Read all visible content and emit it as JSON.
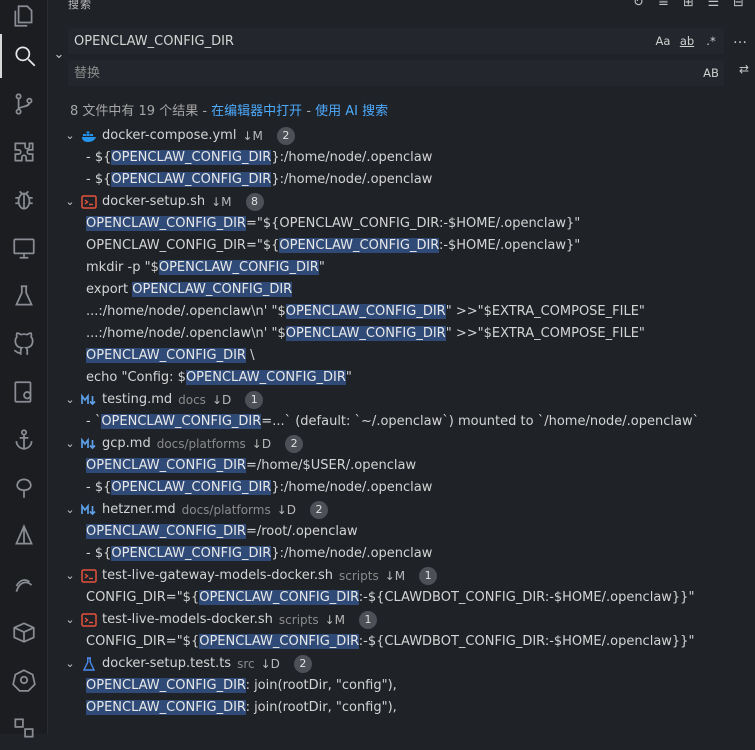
{
  "panel": {
    "title": "搜索"
  },
  "search": {
    "value": "OPENCLAW_CONFIG_DIR",
    "opt_case": "Aa",
    "opt_word": "ab",
    "opt_regex": ".*"
  },
  "replace": {
    "placeholder": "替换",
    "opt_preserve": "AB"
  },
  "summary": {
    "text": "8 文件中有 19 个结果 - ",
    "open_editor": "在编辑器中打开",
    "sep": " - ",
    "ai": "使用 AI 搜索"
  },
  "files": [
    {
      "name": "docker-compose.yml",
      "dir": "",
      "status": "↓M",
      "count": "2",
      "icon": "docker-icon",
      "matches": [
        {
          "pre": "- ${",
          "hl": "OPENCLAW_CONFIG_DIR",
          "post": "}:/home/node/.openclaw"
        },
        {
          "pre": "- ${",
          "hl": "OPENCLAW_CONFIG_DIR",
          "post": "}:/home/node/.openclaw"
        }
      ]
    },
    {
      "name": "docker-setup.sh",
      "dir": "",
      "status": "↓M",
      "count": "8",
      "icon": "shell-icon",
      "matches": [
        {
          "pre": "",
          "hl": "OPENCLAW_CONFIG_DIR",
          "post": "=\"${OPENCLAW_CONFIG_DIR:-$HOME/.openclaw}\""
        },
        {
          "pre": "OPENCLAW_CONFIG_DIR=\"${",
          "hl": "OPENCLAW_CONFIG_DIR",
          "post": ":-$HOME/.openclaw}\""
        },
        {
          "pre": "mkdir -p \"$",
          "hl": "OPENCLAW_CONFIG_DIR",
          "post": "\""
        },
        {
          "pre": "export ",
          "hl": "OPENCLAW_CONFIG_DIR",
          "post": ""
        },
        {
          "pre": "...:/home/node/.openclaw\\n' \"$",
          "hl": "OPENCLAW_CONFIG_DIR",
          "post": "\" >>\"$EXTRA_COMPOSE_FILE\""
        },
        {
          "pre": "...:/home/node/.openclaw\\n' \"$",
          "hl": "OPENCLAW_CONFIG_DIR",
          "post": "\" >>\"$EXTRA_COMPOSE_FILE\""
        },
        {
          "pre": "",
          "hl": "OPENCLAW_CONFIG_DIR",
          "post": " \\"
        },
        {
          "pre": "echo \"Config: $",
          "hl": "OPENCLAW_CONFIG_DIR",
          "post": "\""
        }
      ]
    },
    {
      "name": "testing.md",
      "dir": "docs",
      "status": "↓D",
      "count": "1",
      "icon": "markdown-icon",
      "matches": [
        {
          "pre": "- `",
          "hl": "OPENCLAW_CONFIG_DIR",
          "post": "=...` (default: `~/.openclaw`) mounted to `/home/node/.openclaw`"
        }
      ]
    },
    {
      "name": "gcp.md",
      "dir": "docs/platforms",
      "status": "↓D",
      "count": "2",
      "icon": "markdown-icon",
      "matches": [
        {
          "pre": "",
          "hl": "OPENCLAW_CONFIG_DIR",
          "post": "=/home/$USER/.openclaw"
        },
        {
          "pre": "- ${",
          "hl": "OPENCLAW_CONFIG_DIR",
          "post": "}:/home/node/.openclaw"
        }
      ]
    },
    {
      "name": "hetzner.md",
      "dir": "docs/platforms",
      "status": "↓D",
      "count": "2",
      "icon": "markdown-icon",
      "matches": [
        {
          "pre": "",
          "hl": "OPENCLAW_CONFIG_DIR",
          "post": "=/root/.openclaw"
        },
        {
          "pre": "- ${",
          "hl": "OPENCLAW_CONFIG_DIR",
          "post": "}:/home/node/.openclaw"
        }
      ]
    },
    {
      "name": "test-live-gateway-models-docker.sh",
      "dir": "scripts",
      "status": "↓M",
      "count": "1",
      "icon": "shell-icon",
      "matches": [
        {
          "pre": "CONFIG_DIR=\"${",
          "hl": "OPENCLAW_CONFIG_DIR",
          "post": ":-${CLAWDBOT_CONFIG_DIR:-$HOME/.openclaw}}\""
        }
      ]
    },
    {
      "name": "test-live-models-docker.sh",
      "dir": "scripts",
      "status": "↓M",
      "count": "1",
      "icon": "shell-icon",
      "matches": [
        {
          "pre": "CONFIG_DIR=\"${",
          "hl": "OPENCLAW_CONFIG_DIR",
          "post": ":-${CLAWDBOT_CONFIG_DIR:-$HOME/.openclaw}}\""
        }
      ]
    },
    {
      "name": "docker-setup.test.ts",
      "dir": "src",
      "status": "↓D",
      "count": "2",
      "icon": "flask-icon",
      "matches": [
        {
          "pre": "",
          "hl": "OPENCLAW_CONFIG_DIR",
          "post": ": join(rootDir, \"config\"),"
        },
        {
          "pre": "",
          "hl": "OPENCLAW_CONFIG_DIR",
          "post": ": join(rootDir, \"config\"),"
        }
      ]
    }
  ]
}
